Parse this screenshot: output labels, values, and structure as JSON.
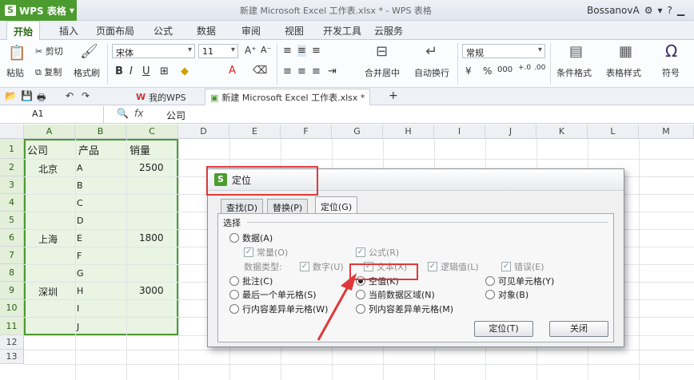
{
  "app": {
    "name": "WPS 表格",
    "window_title": "新建 Microsoft Excel 工作表.xlsx * - WPS 表格",
    "user": "BossanovA"
  },
  "ribbon_tabs": [
    "开始",
    "插入",
    "页面布局",
    "公式",
    "数据",
    "审阅",
    "视图",
    "开发工具",
    "云服务"
  ],
  "ribbon": {
    "paste": "粘贴",
    "cut": "剪切",
    "copy": "复制",
    "format_painter": "格式刷",
    "font_name": "宋体",
    "font_size": "11",
    "merge": "合并居中",
    "wrap": "自动换行",
    "number_format": "常规",
    "cond_format": "条件格式",
    "table_style": "表格样式",
    "symbol": "符号",
    "bold": "B",
    "italic": "I",
    "underline": "U",
    "percent": "%",
    "thousands": "000"
  },
  "doc_tabs": {
    "mywps": "我的WPS",
    "doc": "新建 Microsoft Excel 工作表.xlsx *",
    "add": "+"
  },
  "formula_bar": {
    "cell_ref": "A1",
    "fx": "fx",
    "value": "公司"
  },
  "columns": [
    "A",
    "B",
    "C",
    "D",
    "E",
    "F",
    "G",
    "H",
    "I",
    "J",
    "K",
    "L",
    "M"
  ],
  "rows": [
    "1",
    "2",
    "3",
    "4",
    "5",
    "6",
    "7",
    "8",
    "9",
    "10",
    "11",
    "12",
    "13"
  ],
  "cells": {
    "A1": "公司",
    "B1": "产品",
    "C1": "销量",
    "A2": "北京",
    "B2": "A",
    "C2": "2500",
    "B3": "B",
    "B4": "C",
    "B5": "D",
    "A6": "上海",
    "B6": "E",
    "C6": "1800",
    "B7": "F",
    "B8": "G",
    "A9": "深圳",
    "B9": "H",
    "C9": "3000",
    "B10": "I",
    "B11": "J"
  },
  "dialog": {
    "title": "定位",
    "tabs": [
      "查找(D)",
      "替换(P)",
      "定位(G)"
    ],
    "group": "选择",
    "data": "数据(A)",
    "constants": "常量(O)",
    "formulas": "公式(R)",
    "data_type": "数据类型:",
    "number": "数字(U)",
    "text": "文本(X)",
    "logical": "逻辑值(L)",
    "error": "错误(E)",
    "comments": "批注(C)",
    "blank": "空值(K)",
    "visible": "可见单元格(Y)",
    "last_cell": "最后一个单元格(S)",
    "current_region": "当前数据区域(N)",
    "objects": "对象(B)",
    "row_diff": "行内容差异单元格(W)",
    "col_diff": "列内容差异单元格(M)",
    "locate_btn": "定位(T)",
    "close_btn": "关闭"
  },
  "colors": {
    "accent": "#4b9b2f",
    "highlight": "#e0383a"
  }
}
